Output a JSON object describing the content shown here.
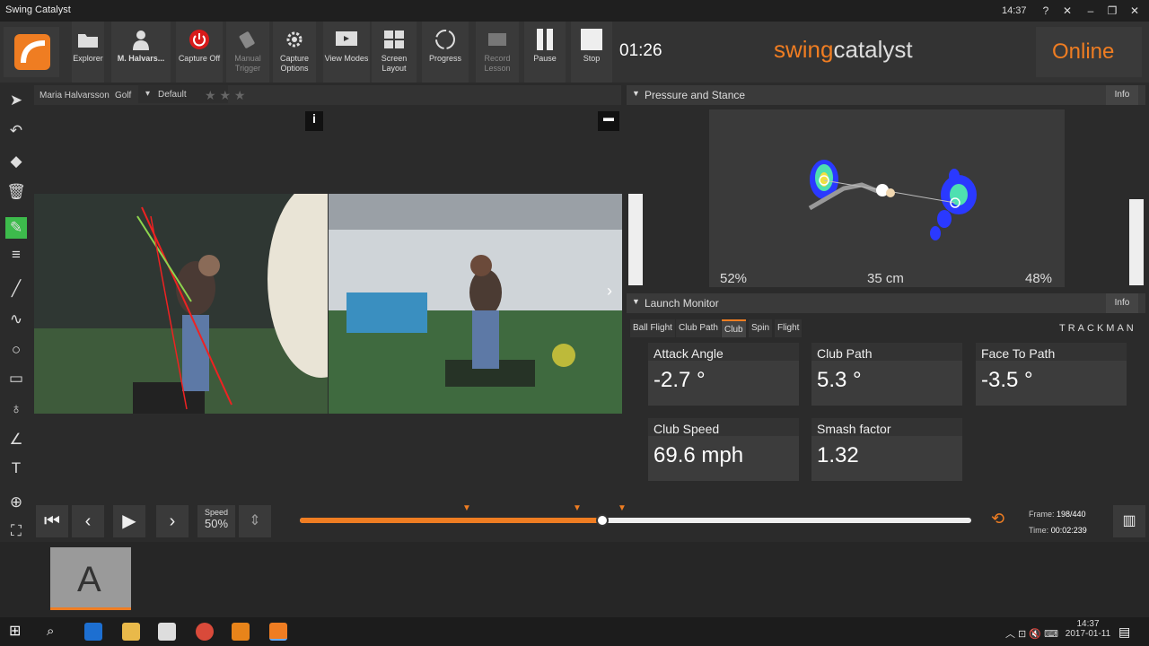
{
  "window": {
    "title": "Swing Catalyst",
    "clock": "14:37",
    "help": "?",
    "restore": "✕",
    "min": "–",
    "max": "❐",
    "close": "✕"
  },
  "toolbar": {
    "explorer": "Explorer",
    "user": "M. Halvars...",
    "capture": "Capture Off",
    "manual_trigger": "Manual Trigger",
    "capture_options": "Capture Options",
    "view_modes": "View Modes",
    "screen_layout": "Screen Layout",
    "progress": "Progress",
    "record_lesson": "Record Lesson",
    "pause": "Pause",
    "stop": "Stop",
    "timer": "01:26"
  },
  "brand": {
    "swing": "swing",
    "catalyst": "catalyst",
    "online": "Online"
  },
  "video": {
    "player": "Maria Halvarsson",
    "sport": "Golf",
    "preset": "Default"
  },
  "pressure": {
    "title": "Pressure and Stance",
    "info": "Info",
    "left_pct": "52%",
    "stance": "35 cm",
    "right_pct": "48%"
  },
  "launch": {
    "title": "Launch Monitor",
    "info": "Info",
    "tabs": [
      "Ball Flight",
      "Club Path",
      "Club",
      "Spin",
      "Flight"
    ],
    "brand": "TRACKMAN",
    "metrics": [
      {
        "label": "Attack Angle",
        "value": "-2.7 °"
      },
      {
        "label": "Club Path",
        "value": "5.3 °"
      },
      {
        "label": "Face To Path",
        "value": "-3.5 °"
      },
      {
        "label": "Club Speed",
        "value": "69.6 mph"
      },
      {
        "label": "Smash factor",
        "value": "1.32"
      }
    ]
  },
  "playback": {
    "speed_label": "Speed",
    "speed": "50%",
    "frame_label": "Frame:",
    "frame": "198/440",
    "time_label": "Time:",
    "time": "00:02:239",
    "progress": 0.45
  },
  "thumb": {
    "label": "A"
  },
  "taskbar": {
    "time": "14:37",
    "date": "2017-01-11"
  }
}
